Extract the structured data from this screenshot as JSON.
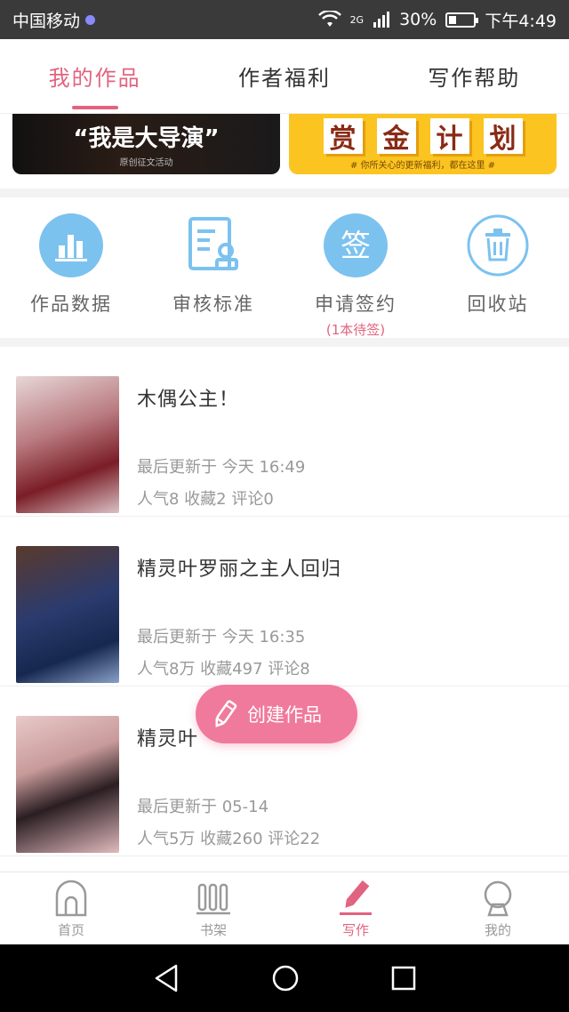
{
  "status_bar": {
    "carrier": "中国移动",
    "network": "2G",
    "battery": "30%",
    "battery_level": 0.3,
    "time": "下午4:49"
  },
  "top_tabs": [
    {
      "label": "我的作品",
      "active": true
    },
    {
      "label": "作者福利",
      "active": false
    },
    {
      "label": "写作帮助",
      "active": false
    }
  ],
  "banners": {
    "left": {
      "title": "“我是大导演”",
      "subtitle": "原创征文活动"
    },
    "right": {
      "chars": [
        "赏",
        "金",
        "计",
        "划"
      ],
      "subtitle": "# 你所关心的更新福利，都在这里 #"
    }
  },
  "actions": [
    {
      "label": "作品数据",
      "icon": "bar-chart-icon"
    },
    {
      "label": "审核标准",
      "icon": "document-stamp-icon"
    },
    {
      "label": "申请签约",
      "icon": "sign-icon",
      "note": "(1本待签)",
      "icon_text": "签"
    },
    {
      "label": "回收站",
      "icon": "trash-icon"
    }
  ],
  "works": [
    {
      "title": "木偶公主！",
      "updated": "最后更新于 今天 16:49",
      "stats": "人气8 收藏2 评论0"
    },
    {
      "title": "精灵叶罗丽之主人回归",
      "updated": "最后更新于 今天 16:35",
      "stats": "人气8万 收藏497 评论8"
    },
    {
      "title": "精灵叶",
      "updated": "最后更新于 05-14",
      "stats": "人气5万 收藏260 评论22"
    }
  ],
  "create_button": {
    "label": "创建作品"
  },
  "bottom_nav": [
    {
      "label": "首页",
      "icon": "home-icon",
      "active": false
    },
    {
      "label": "书架",
      "icon": "bookshelf-icon",
      "active": false
    },
    {
      "label": "写作",
      "icon": "pencil-icon",
      "active": true
    },
    {
      "label": "我的",
      "icon": "profile-icon",
      "active": false
    }
  ],
  "colors": {
    "accent": "#e2637f",
    "create_button": "#f07a9c",
    "icon_blue": "#7cc2ef"
  }
}
